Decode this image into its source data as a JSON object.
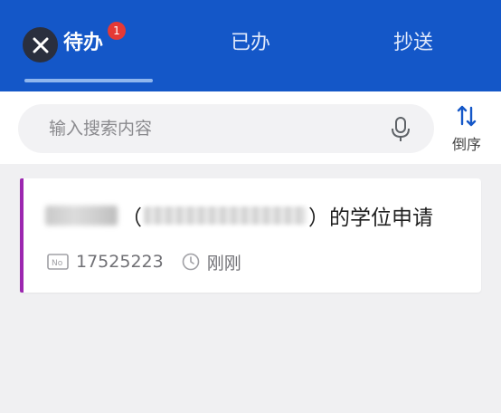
{
  "header": {
    "tabs": [
      {
        "label": "待办",
        "active": true,
        "badge": "1"
      },
      {
        "label": "已办",
        "active": false
      },
      {
        "label": "抄送",
        "active": false
      }
    ],
    "accent_color": "#1457c8"
  },
  "search": {
    "placeholder": "输入搜索内容",
    "value": ""
  },
  "sort": {
    "label": "倒序"
  },
  "list": {
    "items": [
      {
        "title_paren_open": "（",
        "title_paren_close": "）",
        "title_suffix": "的学位申请",
        "number": "17525223",
        "time": "刚刚",
        "accent_color": "#9c27b0"
      }
    ]
  }
}
